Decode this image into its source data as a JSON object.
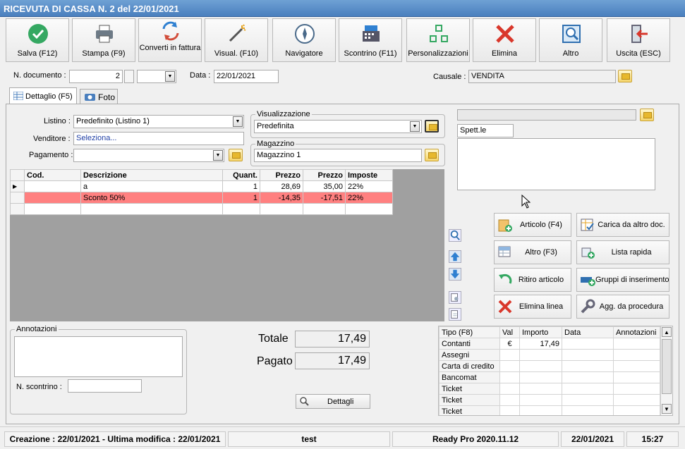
{
  "window": {
    "title": "RICEVUTA DI CASSA N. 2 del 22/01/2021"
  },
  "toolbar": [
    {
      "label": "Salva (F12)",
      "icon": "check-icon"
    },
    {
      "label": "Stampa (F9)",
      "icon": "printer-icon"
    },
    {
      "label": "Converti in fattura",
      "icon": "convert-icon"
    },
    {
      "label": "Visual. (F10)",
      "icon": "wand-icon"
    },
    {
      "label": "Navigatore",
      "icon": "compass-icon"
    },
    {
      "label": "Scontrino (F11)",
      "icon": "cash-register-icon"
    },
    {
      "label": "Personalizzazioni",
      "icon": "grid-icon"
    },
    {
      "label": "Elimina",
      "icon": "delete-icon"
    },
    {
      "label": "Altro",
      "icon": "magnifier-icon"
    },
    {
      "label": "Uscita (ESC)",
      "icon": "exit-icon"
    }
  ],
  "header": {
    "doc_label": "N. documento :",
    "doc_number": "2",
    "date_label": "Data :",
    "date": "22/01/2021",
    "causale_label": "Causale :",
    "causale": "VENDITA"
  },
  "tabs": [
    {
      "label": "Dettaglio (F5)"
    },
    {
      "label": "Foto"
    }
  ],
  "form": {
    "listino_label": "Listino :",
    "listino": "Predefinito (Listino 1)",
    "venditore_label": "Venditore :",
    "venditore": "Seleziona...",
    "pagamento_label": "Pagamento :",
    "pagamento": ""
  },
  "visualizzazione": {
    "title": "Visualizzazione",
    "value": "Predefinita"
  },
  "magazzino": {
    "title": "Magazzino",
    "value": "Magazzino 1"
  },
  "customer": {
    "field": "",
    "salutation": "Spett.le",
    "address": ""
  },
  "grid": {
    "columns": [
      "Cod.",
      "Descrizione",
      "Quant.",
      "Prezzo",
      "Prezzo",
      "Imposte"
    ],
    "rows": [
      {
        "cod": "",
        "descr": "a",
        "qty": "1",
        "price": "28,69",
        "price2": "35,00",
        "tax": "22%",
        "highlight": false
      },
      {
        "cod": "",
        "descr": "Sconto 50%",
        "qty": "1",
        "price": "-14,35",
        "price2": "-17,51",
        "tax": "22%",
        "highlight": true
      }
    ]
  },
  "side_buttons": [
    {
      "label": "Articolo (F4)",
      "icon": "article-icon"
    },
    {
      "label": "Carica da altro doc.",
      "icon": "load-doc-icon"
    },
    {
      "label": "Altro (F3)",
      "icon": "table-icon"
    },
    {
      "label": "Lista rapida",
      "icon": "quick-list-icon"
    },
    {
      "label": "Ritiro articolo",
      "icon": "return-arrow-icon"
    },
    {
      "label": "Gruppi di inserimento",
      "icon": "group-insert-icon"
    },
    {
      "label": "Elimina linea",
      "icon": "delete-line-icon"
    },
    {
      "label": "Agg. da procedura",
      "icon": "wrench-icon"
    }
  ],
  "annotazioni": {
    "title": "Annotazioni",
    "value": "",
    "scontrino_label": "N. scontrino :",
    "scontrino": ""
  },
  "totals": {
    "totale_label": "Totale",
    "totale": "17,49",
    "pagato_label": "Pagato",
    "pagato": "17,49",
    "dettagli": "Dettagli"
  },
  "payments": {
    "columns": [
      "Tipo (F8)",
      "Val",
      "Importo",
      "Data",
      "Annotazioni"
    ],
    "rows": [
      {
        "tipo": "Contanti",
        "val": "€",
        "importo": "17,49"
      },
      {
        "tipo": "Assegni",
        "val": "",
        "importo": ""
      },
      {
        "tipo": "Carta di credito",
        "val": "",
        "importo": ""
      },
      {
        "tipo": "Bancomat",
        "val": "",
        "importo": ""
      },
      {
        "tipo": "Ticket",
        "val": "",
        "importo": ""
      },
      {
        "tipo": "Ticket",
        "val": "",
        "importo": ""
      },
      {
        "tipo": "Ticket",
        "val": "",
        "importo": ""
      }
    ]
  },
  "status": {
    "created": "Creazione : 22/01/2021 - Ultima modifica : 22/01/2021",
    "user": "test",
    "version": "Ready Pro 2020.11.12",
    "date": "22/01/2021",
    "time": "15:27"
  },
  "colors": {
    "title_bar": "#4a7fbe",
    "discount_row": "#ff8080",
    "grid_bg": "#a0a0a0"
  }
}
